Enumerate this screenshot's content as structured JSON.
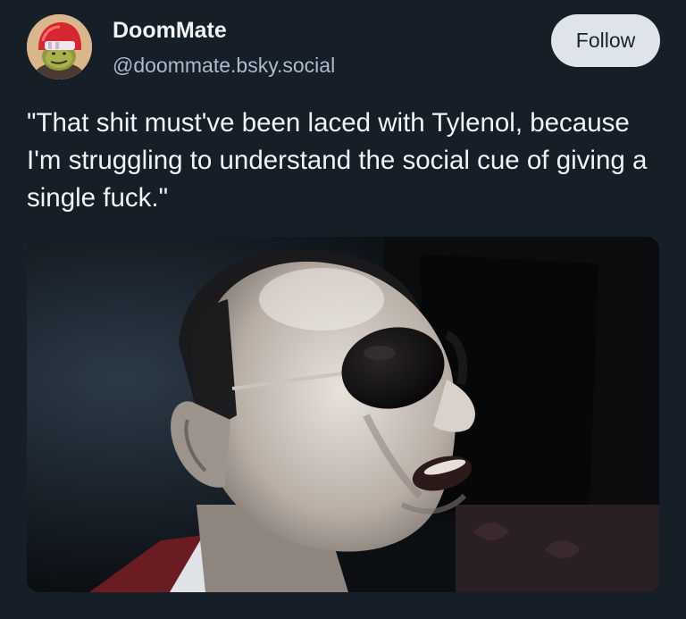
{
  "author": {
    "display_name": "DoomMate",
    "handle": "@doommate.bsky.social",
    "avatar_icon": "cartoon-character-red-helmet-icon"
  },
  "follow_button": {
    "label": "Follow"
  },
  "post": {
    "text": "\"That shit must've been laced with Tylenol, because I'm struggling to understand the social cue of giving a single fuck.\""
  },
  "colors": {
    "background": "#161e27",
    "text": "#f1f3f5",
    "handle_text": "#aebbc9",
    "button_bg": "#dfe4ea",
    "button_text": "#1b2430"
  }
}
